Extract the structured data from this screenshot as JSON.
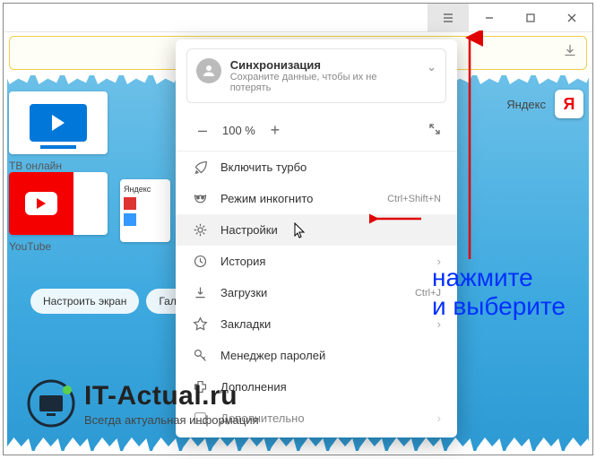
{
  "titlebar": {
    "min": "–",
    "max": "□",
    "close": "×"
  },
  "sidebar": {
    "tile_tv_caption": "ТВ онлайн",
    "tile_yt_caption": "YouTube",
    "tile3_text": "Яндекс",
    "pill_configure": "Настроить экран",
    "pill_gal": "Гал"
  },
  "yandex": {
    "label": "Яндекс",
    "letter": "Я"
  },
  "menu": {
    "sync_title": "Синхронизация",
    "sync_sub": "Сохраните данные, чтобы их не потерять",
    "zoom_minus": "–",
    "zoom_value": "100 %",
    "zoom_plus": "+",
    "items": [
      {
        "label": "Включить турбо",
        "shortcut": "",
        "chev": false
      },
      {
        "label": "Режим инкогнито",
        "shortcut": "Ctrl+Shift+N",
        "chev": false
      },
      {
        "label": "Настройки",
        "shortcut": "",
        "chev": false
      },
      {
        "label": "История",
        "shortcut": "",
        "chev": true
      },
      {
        "label": "Загрузки",
        "shortcut": "Ctrl+J",
        "chev": false
      },
      {
        "label": "Закладки",
        "shortcut": "",
        "chev": true
      },
      {
        "label": "Менеджер паролей",
        "shortcut": "",
        "chev": false
      },
      {
        "label": "Дополнения",
        "shortcut": "",
        "chev": false
      },
      {
        "label": "Дополнительно",
        "shortcut": "",
        "chev": true
      }
    ]
  },
  "annotation": {
    "line1": "нажмите",
    "line2": "и выберите"
  },
  "watermark": {
    "title": "IT-Actual.ru",
    "sub": "Всегда актуальная информация"
  }
}
